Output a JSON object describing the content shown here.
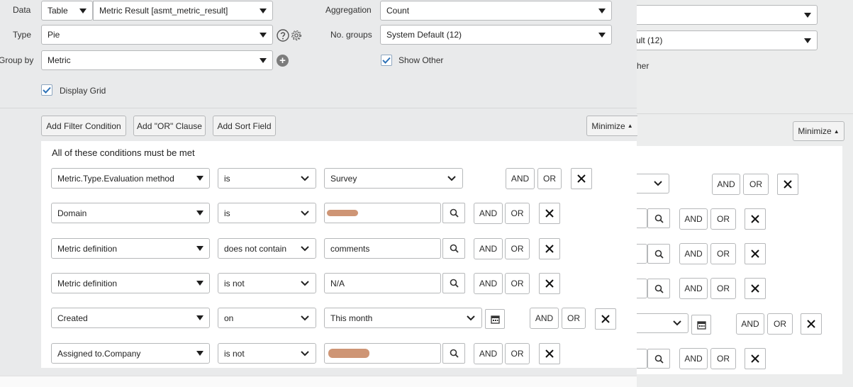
{
  "config": {
    "data_label": "Data",
    "data_source_type": "Table",
    "data_table": "Metric Result [asmt_metric_result]",
    "type_label": "Type",
    "type_value": "Pie",
    "group_by_label": "Group by",
    "group_by_value": "Metric",
    "aggregation_label": "Aggregation",
    "aggregation_value": "Count",
    "no_groups_label": "No. groups",
    "no_groups_value": "System Default (12)",
    "show_other_label": "Show Other",
    "display_grid_label": "Display Grid",
    "show_other_checked": true,
    "display_grid_checked": true
  },
  "background_window": {
    "no_groups_value_partial": "ult (12)",
    "show_other_partial": "her",
    "minimize_label": "Minimize",
    "and_label": "AND",
    "or_label": "OR"
  },
  "filter_toolbar": {
    "add_filter_condition": "Add Filter Condition",
    "add_or_clause": "Add \"OR\" Clause",
    "add_sort_field": "Add Sort Field",
    "minimize_label": "Minimize"
  },
  "conditions_header": "All of these conditions must be met",
  "conditions": [
    {
      "field": "Metric.Type.Evaluation method",
      "operator": "is",
      "value": "Survey",
      "value_kind": "dropdown",
      "and_label": "AND",
      "or_label": "OR"
    },
    {
      "field": "Domain",
      "operator": "is",
      "value": "",
      "value_kind": "lookup",
      "redacted": true,
      "and_label": "AND",
      "or_label": "OR"
    },
    {
      "field": "Metric definition",
      "operator": "does not contain",
      "value": "comments",
      "value_kind": "lookup",
      "and_label": "AND",
      "or_label": "OR"
    },
    {
      "field": "Metric definition",
      "operator": "is not",
      "value": "N/A",
      "value_kind": "lookup",
      "and_label": "AND",
      "or_label": "OR"
    },
    {
      "field": "Created",
      "operator": "on",
      "value": "This month",
      "value_kind": "date",
      "and_label": "AND",
      "or_label": "OR"
    },
    {
      "field": "Assigned to.Company",
      "operator": "is not",
      "value": "",
      "value_kind": "lookup",
      "redacted": true,
      "and_label": "AND",
      "or_label": "OR"
    }
  ],
  "colors": {
    "page_bg": "#e9eaeb",
    "panel_bg": "#ffffff",
    "border": "#b6b8ba",
    "check_accent": "#2f73b8",
    "redaction": "#c98a66"
  }
}
